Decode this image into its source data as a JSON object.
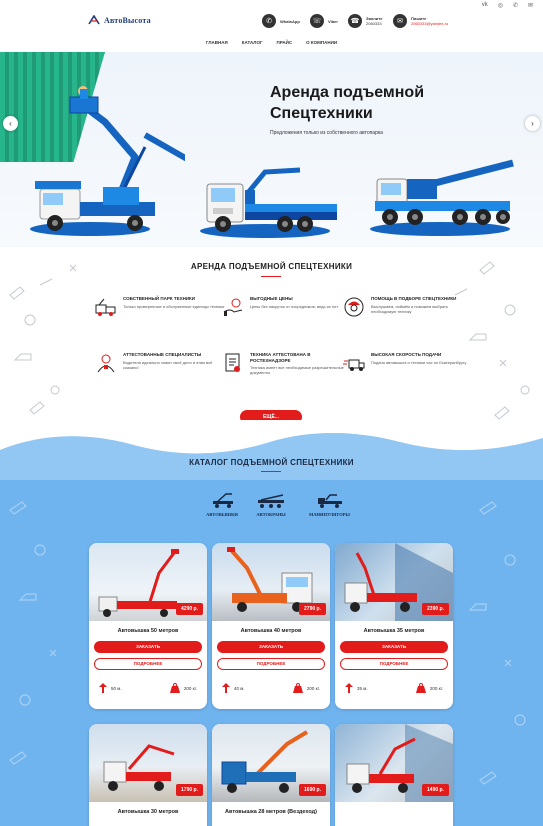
{
  "social": [
    "vk-icon",
    "instagram-icon",
    "phone-icon",
    "mail-icon"
  ],
  "header": {
    "logo": "АвтоВысота",
    "contacts": [
      {
        "icon": "whatsapp-icon",
        "label": "WhatsApp",
        "value": ""
      },
      {
        "icon": "viber-icon",
        "label": "Viber",
        "value": ""
      },
      {
        "icon": "phone-icon",
        "label": "Звоните",
        "value": "2060333"
      },
      {
        "icon": "mail-icon",
        "label": "Пишите",
        "value": "2060333@yandex.ru"
      }
    ]
  },
  "nav": [
    "ГЛАВНАЯ",
    "КАТАЛОГ",
    "ПРАЙС",
    "О КОМПАНИИ"
  ],
  "hero": {
    "title_line1": "Аренда подъемной",
    "title_line2": "Спецтехники",
    "subtitle": "Предложения только из собственного автопарка"
  },
  "services": {
    "title": "АРЕНДА ПОДЪЕМНОЙ СПЕЦТЕХНИКИ",
    "features": [
      {
        "title": "СОБСТВЕННЫЙ ПАРК ТЕХНИКИ",
        "desc": "Только проверенные и обслуженные единицы техники",
        "icon": "truck-icon"
      },
      {
        "title": "ВЫГОДНЫЕ ЦЕНЫ",
        "desc": "Цены без накруток от посредников, ведь их нет",
        "icon": "money-hand-icon"
      },
      {
        "title": "ПОМОЩЬ В ПОДБОРЕ СПЕЦТЕХНИКИ",
        "desc": "Выслушаем, поймём и поможем выбрать необходимую технику",
        "icon": "worker-icon"
      },
      {
        "title": "АТТЕСТОВАННЫЕ СПЕЦИАЛИСТЫ",
        "desc": "Водители идеально знают своё дело и этим всё сказано!",
        "icon": "specialist-icon"
      },
      {
        "title": "ТЕХНИКА АТТЕСТОВАНА В РОСТЕХНАДЗОРЕ",
        "desc": "Техника имеет все необходимые разрешительные документы",
        "icon": "document-icon"
      },
      {
        "title": "ВЫСОКАЯ СКОРОСТЬ ПОДАЧИ",
        "desc": "Подача автовышек и техники час по Екатеринбургу",
        "icon": "fast-truck-icon"
      }
    ],
    "more_button": "ЕЩЁ..."
  },
  "catalog": {
    "title": "КАТАЛОГ ПОДЪЕМНОЙ СПЕЦТЕХНИКИ",
    "tabs": [
      "АВТОВЫШКИ",
      "АВТОКРАНЫ",
      "МАНИПУЛЯТОРЫ"
    ],
    "order_label": "ЗАКАЗАТЬ",
    "details_label": "ПОДРОБНЕЕ",
    "cards": [
      {
        "name": "Автовышка 50 метров",
        "price": "4290 р.",
        "height": "50 м.",
        "load": "200 кг."
      },
      {
        "name": "Автовышка 40 метров",
        "price": "2790 р.",
        "height": "40 м.",
        "load": "200 кг."
      },
      {
        "name": "Автовышка 35 метров",
        "price": "2390 р.",
        "height": "35 м.",
        "load": "200 кг."
      },
      {
        "name": "Автовышка 30 метров",
        "price": "1790 р."
      },
      {
        "name": "Автовышка 28 метров (Вездеход)",
        "price": "1690 р."
      },
      {
        "name": "",
        "price": "1490 р."
      }
    ]
  },
  "colors": {
    "accent": "#e21b1b",
    "brand": "#1565c0",
    "catalog_bg": "#6fb3ef"
  }
}
